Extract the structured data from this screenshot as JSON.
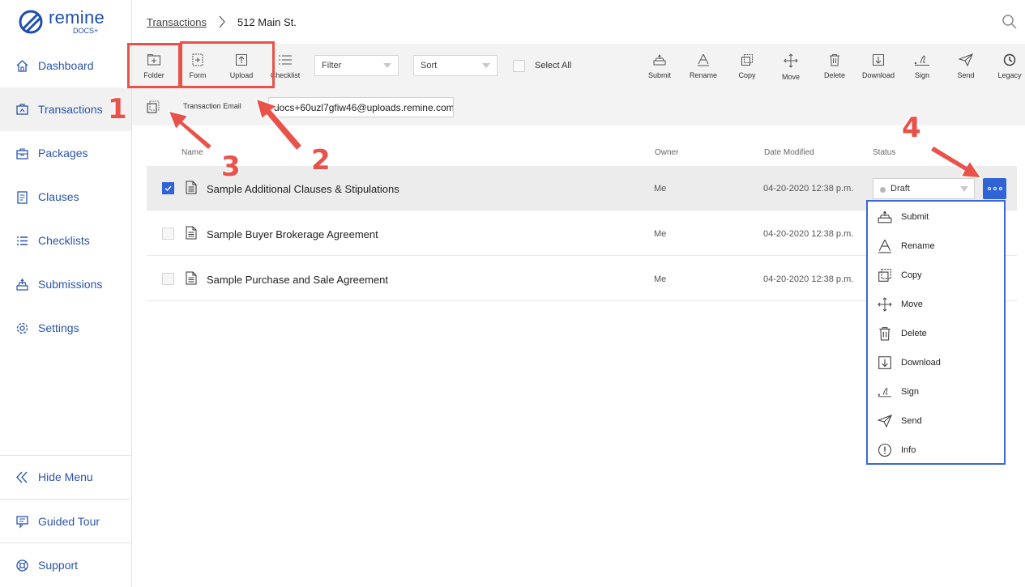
{
  "logo": {
    "word": "remine",
    "sub": "DOCS+"
  },
  "sidebar": {
    "items": [
      {
        "label": "Dashboard",
        "icon": "home-icon"
      },
      {
        "label": "Transactions",
        "icon": "transaction-icon",
        "active": true
      },
      {
        "label": "Packages",
        "icon": "package-icon"
      },
      {
        "label": "Clauses",
        "icon": "clause-icon"
      },
      {
        "label": "Checklists",
        "icon": "checklist-icon"
      },
      {
        "label": "Submissions",
        "icon": "submissions-icon"
      },
      {
        "label": "Settings",
        "icon": "gear-icon"
      }
    ],
    "bottom": [
      {
        "label": "Hide Menu",
        "icon": "double-chevron-left-icon"
      },
      {
        "label": "Guided Tour",
        "icon": "tour-icon"
      },
      {
        "label": "Support",
        "icon": "support-icon"
      }
    ]
  },
  "breadcrumb": {
    "parent": "Transactions",
    "current": "512 Main St."
  },
  "toolbar": {
    "folder": "Folder",
    "form": "Form",
    "upload": "Upload",
    "checklist": "Checklist",
    "filter": "Filter",
    "sort": "Sort",
    "select_all": "Select All",
    "actions": [
      "Submit",
      "Rename",
      "Copy",
      "Move",
      "Delete",
      "Download",
      "Sign",
      "Send",
      "Legacy"
    ],
    "email_label": "Transaction Email",
    "email_value": "docs+60uzl7gfiw46@uploads.remine.com"
  },
  "table": {
    "headers": {
      "name": "Name",
      "owner": "Owner",
      "date": "Date Modified",
      "status": "Status"
    },
    "rows": [
      {
        "name": "Sample Additional Clauses & Stipulations",
        "owner": "Me",
        "date": "04-20-2020 12:38 p.m.",
        "status": "Draft",
        "checked": true
      },
      {
        "name": "Sample Buyer Brokerage Agreement",
        "owner": "Me",
        "date": "04-20-2020 12:38 p.m.",
        "checked": false
      },
      {
        "name": "Sample Purchase and Sale Agreement",
        "owner": "Me",
        "date": "04-20-2020 12:38 p.m.",
        "checked": false
      }
    ]
  },
  "row_menu": {
    "items": [
      {
        "label": "Submit",
        "icon": "submit-icon"
      },
      {
        "label": "Rename",
        "icon": "rename-icon"
      },
      {
        "label": "Copy",
        "icon": "copy-icon"
      },
      {
        "label": "Move",
        "icon": "move-icon"
      },
      {
        "label": "Delete",
        "icon": "trash-icon"
      },
      {
        "label": "Download",
        "icon": "download-icon"
      },
      {
        "label": "Sign",
        "icon": "sign-icon"
      },
      {
        "label": "Send",
        "icon": "send-icon"
      },
      {
        "label": "Info",
        "icon": "info-icon"
      }
    ]
  },
  "annotations": {
    "n1": "1",
    "n2": "2",
    "n3": "3",
    "n4": "4"
  },
  "colors": {
    "accent": "#2f63d6",
    "nav": "#2a54ad",
    "annotation": "#e9524a"
  }
}
